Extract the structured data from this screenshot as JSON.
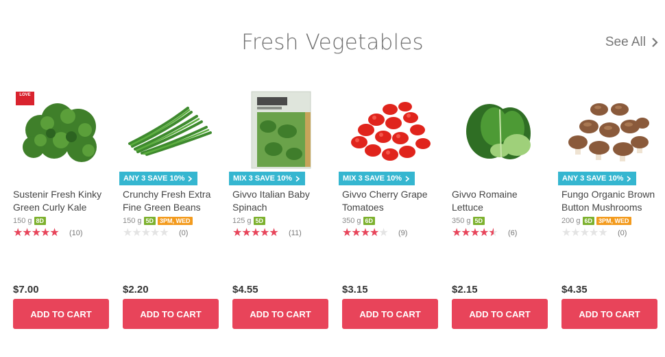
{
  "section": {
    "title": "Fresh Vegetables",
    "see_all": "See All"
  },
  "colors": {
    "accent": "#e8445a",
    "promo": "#35b6d0",
    "days_tag": "#7db12e",
    "delivery_tag": "#f39b1e"
  },
  "products": [
    {
      "name": "Sustenir Fresh Kinky Green Curly Kale",
      "weight": "150 g",
      "days": "8D",
      "delivery": "",
      "promo": "",
      "badge": "LOVE",
      "rating": 5,
      "reviews": "(10)",
      "price": "$7.00",
      "cta": "ADD TO CART",
      "image_icon": "kale-icon"
    },
    {
      "name": "Crunchy Fresh Extra Fine Green Beans",
      "weight": "150 g",
      "days": "5D",
      "delivery": "3PM, WED",
      "promo": "ANY 3 SAVE 10%",
      "rating": 0,
      "reviews": "(0)",
      "price": "$2.20",
      "cta": "ADD TO CART",
      "image_icon": "green-beans-icon"
    },
    {
      "name": "Givvo Italian Baby Spinach",
      "weight": "125 g",
      "days": "5D",
      "delivery": "",
      "promo": "MIX 3 SAVE 10%",
      "rating": 4.5,
      "reviews": "(11)",
      "price": "$4.55",
      "cta": "ADD TO CART",
      "image_icon": "spinach-bag-icon"
    },
    {
      "name": "Givvo Cherry Grape Tomatoes",
      "weight": "350 g",
      "days": "6D",
      "delivery": "",
      "promo": "MIX 3 SAVE 10%",
      "rating": 3.5,
      "reviews": "(9)",
      "price": "$3.15",
      "cta": "ADD TO CART",
      "image_icon": "tomatoes-icon"
    },
    {
      "name": "Givvo Romaine Lettuce",
      "weight": "350 g",
      "days": "5D",
      "delivery": "",
      "promo": "",
      "rating": 4,
      "reviews": "(6)",
      "price": "$2.15",
      "cta": "ADD TO CART",
      "image_icon": "lettuce-icon"
    },
    {
      "name": "Fungo Organic Brown Button Mushrooms",
      "weight": "200 g",
      "days": "6D",
      "delivery": "3PM, WED",
      "promo": "ANY 3 SAVE 10%",
      "rating": 0,
      "reviews": "(0)",
      "price": "$4.35",
      "cta": "ADD TO CART",
      "image_icon": "mushrooms-icon"
    }
  ]
}
